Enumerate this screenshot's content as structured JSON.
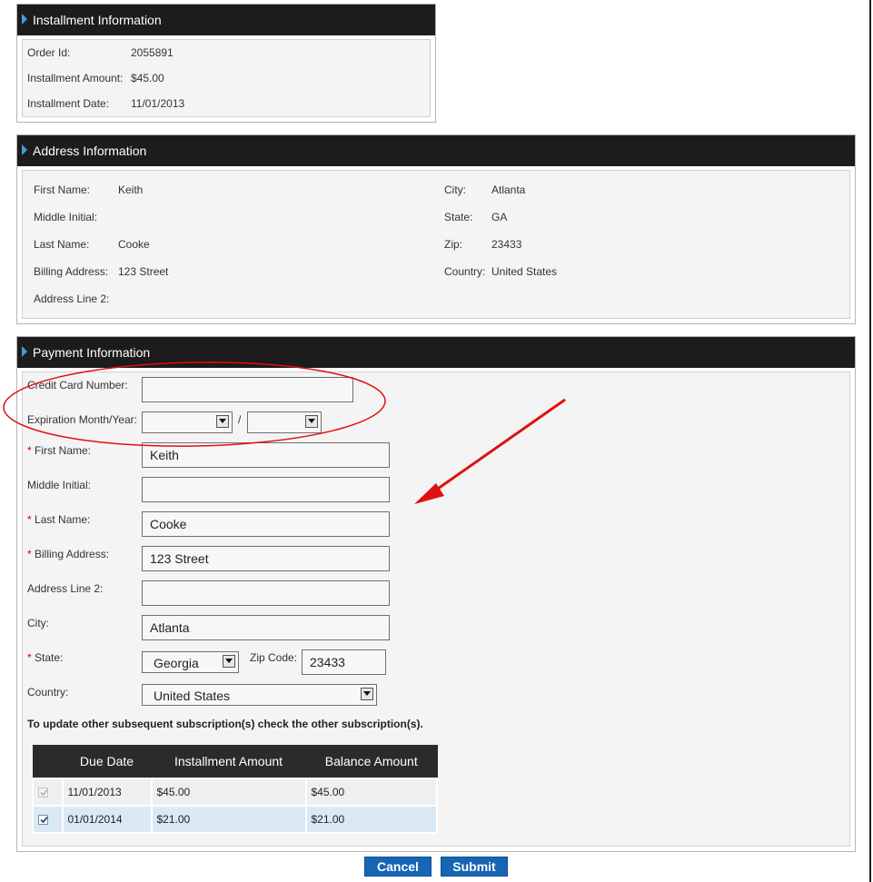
{
  "installment": {
    "title": "Installment Information",
    "order_id_label": "Order Id:",
    "order_id": "2055891",
    "amount_label": "Installment Amount:",
    "amount": "$45.00",
    "date_label": "Installment Date:",
    "date": "11/01/2013"
  },
  "address": {
    "title": "Address Information",
    "first_name_label": "First Name:",
    "first_name": "Keith",
    "middle_initial_label": "Middle Initial:",
    "middle_initial": "",
    "last_name_label": "Last Name:",
    "last_name": "Cooke",
    "billing_label": "Billing Address:",
    "billing": "123 Street",
    "line2_label": "Address Line 2:",
    "line2": "",
    "city_label": "City:",
    "city": "Atlanta",
    "state_label": "State:",
    "state": "GA",
    "zip_label": "Zip:",
    "zip": "23433",
    "country_label": "Country:",
    "country": "United States"
  },
  "payment": {
    "title": "Payment Information",
    "card_label": "Credit Card Number:",
    "card_value": "",
    "exp_label": "Expiration Month/Year:",
    "exp_month": "",
    "exp_separator": "/",
    "exp_year": "",
    "required_mark": "*",
    "first_name_label": "First Name:",
    "first_name": "Keith",
    "middle_initial_label": "Middle Initial:",
    "middle_initial": "",
    "last_name_label": "Last Name:",
    "last_name": "Cooke",
    "billing_label": "Billing Address:",
    "billing": "123 Street",
    "line2_label": "Address Line 2:",
    "line2": "",
    "city_label": "City:",
    "city": "Atlanta",
    "state_label": "State:",
    "state": "Georgia",
    "zip_label": "Zip Code:",
    "zip": "23433",
    "country_label": "Country:",
    "country": "United States",
    "note": "To update other subsequent subscription(s) check the other subscription(s)."
  },
  "schedule": {
    "headers": [
      "Due Date",
      "Installment Amount",
      "Balance Amount"
    ],
    "rows": [
      {
        "checked": true,
        "disabled": true,
        "due_date": "11/01/2013",
        "installment": "$45.00",
        "balance": "$45.00"
      },
      {
        "checked": true,
        "disabled": false,
        "due_date": "01/01/2014",
        "installment": "$21.00",
        "balance": "$21.00"
      }
    ]
  },
  "buttons": {
    "cancel": "Cancel",
    "submit": "Submit"
  },
  "colors": {
    "header_bg": "#1c1c1c",
    "accent_arrow": "#3fa0d8",
    "button_bg": "#1766b5",
    "annotation_red": "#e01010",
    "required_red": "#d00000"
  }
}
